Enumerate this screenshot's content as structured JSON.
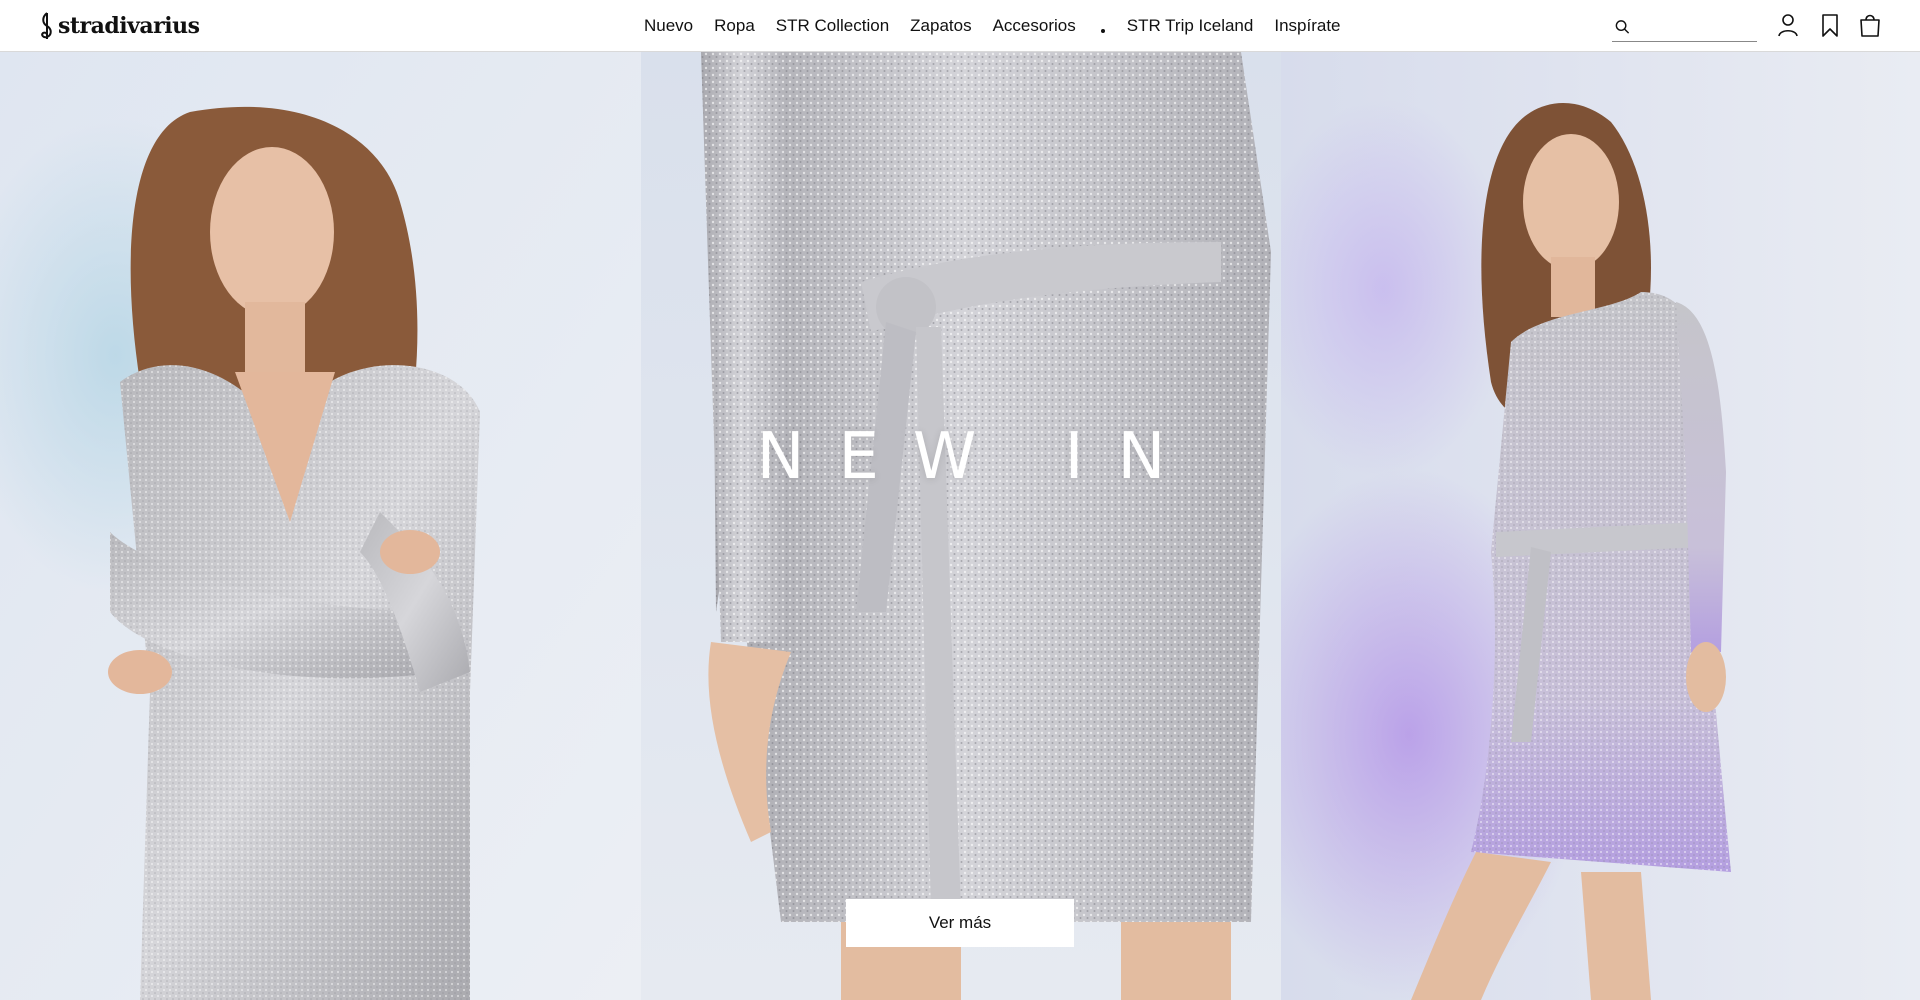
{
  "brand": {
    "logo_text": "stradivarius"
  },
  "nav": {
    "items": [
      {
        "label": "Nuevo"
      },
      {
        "label": "Ropa"
      },
      {
        "label": "STR Collection"
      },
      {
        "label": "Zapatos"
      },
      {
        "label": "Accesorios"
      },
      {
        "label": "STR Trip Iceland"
      },
      {
        "label": "Inspírate"
      }
    ]
  },
  "search": {
    "placeholder": "",
    "value": "",
    "icon": "search-icon"
  },
  "header_icons": [
    "user-icon",
    "bookmark-icon",
    "shopping-bag-icon"
  ],
  "hero": {
    "title": "NEW IN",
    "button_label": "Ver más",
    "panels": [
      {
        "name": "model-arms-crossed"
      },
      {
        "name": "dress-detail-belt"
      },
      {
        "name": "model-standing"
      }
    ]
  },
  "colors": {
    "header_bg": "#ffffff",
    "text": "#111111",
    "backdrop": "#dde3ee",
    "sequin": "#c4c4c8",
    "button_bg": "#ffffff"
  }
}
